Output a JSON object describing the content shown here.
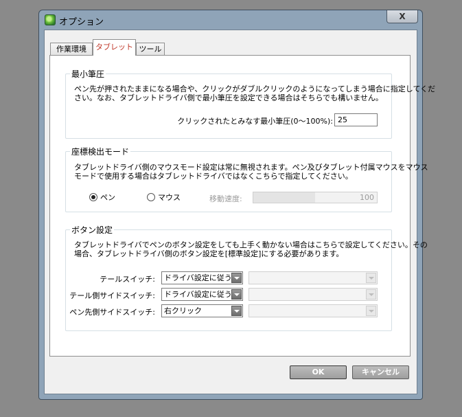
{
  "window": {
    "title": "オプション",
    "close_label": "X"
  },
  "tabs": [
    {
      "label": "作業環境",
      "active": false
    },
    {
      "label": "タブレット",
      "active": true
    },
    {
      "label": "ツール",
      "active": false
    }
  ],
  "min_pressure": {
    "title": "最小筆圧",
    "desc_line1": "ペン先が押されたままになる場合や、クリックがダブルクリックのようになってしまう場合に指定してくだ",
    "desc_line2": "さい。なお、タブレットドライバ側で最小筆圧を設定できる場合はそちらでも構いません。",
    "field_label": "クリックされたとみなす最小筆圧(0〜100%):",
    "field_value": "25"
  },
  "coord_mode": {
    "title": "座標検出モード",
    "desc_line1": "タブレットドライバ側のマウスモード設定は常に無視されます。ペン及びタブレット付属マウスをマウス",
    "desc_line2": "モードで使用する場合はタブレットドライバではなくこちらで指定してください。",
    "option_pen": "ペン",
    "option_mouse": "マウス",
    "selected": "pen",
    "speed_label": "移動速度:",
    "speed_value": "100",
    "speed_fill_fraction": 0.5
  },
  "button_settings": {
    "title": "ボタン設定",
    "desc_line1": "タブレットドライバでペンのボタン設定をしても上手く動かない場合はこちらで設定してください。その",
    "desc_line2": "場合、タブレットドライバ側のボタン設定を[標準設定]にする必要があります。",
    "rows": [
      {
        "label": "テールスイッチ:",
        "value": "ドライバ設定に従う"
      },
      {
        "label": "テール側サイドスイッチ:",
        "value": "ドライバ設定に従う"
      },
      {
        "label": "ペン先側サイドスイッチ:",
        "value": "右クリック"
      }
    ]
  },
  "footer": {
    "ok_label": "OK",
    "cancel_label": "キャンセル"
  }
}
